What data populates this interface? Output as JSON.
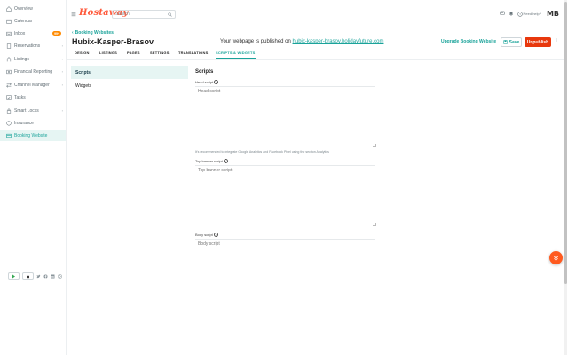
{
  "app": {
    "logo_text": "Hostaway",
    "search_placeholder": "Search",
    "need_help": "Need help?",
    "avatar_initials": "MB"
  },
  "sidebar": {
    "items": [
      {
        "label": "Overview",
        "icon": "home-icon"
      },
      {
        "label": "Calendar",
        "icon": "calendar-icon"
      },
      {
        "label": "Inbox",
        "icon": "inbox-icon",
        "badge": "99+"
      },
      {
        "label": "Reservations",
        "icon": "reservations-icon"
      },
      {
        "label": "Listings",
        "icon": "listings-icon"
      },
      {
        "label": "Financial Reporting",
        "icon": "financial-icon"
      },
      {
        "label": "Channel Manager",
        "icon": "channel-icon"
      },
      {
        "label": "Tasks",
        "icon": "tasks-icon"
      },
      {
        "label": "Smart Locks",
        "icon": "lock-icon"
      },
      {
        "label": "Insurance",
        "icon": "insurance-icon"
      },
      {
        "label": "Booking Website",
        "icon": "globe-icon"
      }
    ]
  },
  "header": {
    "breadcrumb": "Booking Websites",
    "title": "Hubix-Kasper-Brasov",
    "published_prefix": "Your webpage is published on",
    "published_url": "hubix-kasper-brasov.holidayfuture.com",
    "upgrade_label": "Upgrade Booking Website",
    "save_label": "Save",
    "unpublish_label": "Unpublish"
  },
  "tabs": [
    {
      "label": "DESIGN"
    },
    {
      "label": "LISTINGS"
    },
    {
      "label": "PAGES"
    },
    {
      "label": "SETTINGS"
    },
    {
      "label": "TRANSLATIONS"
    },
    {
      "label": "SCRIPTS & WIDGETS",
      "active": true
    }
  ],
  "subnav": [
    {
      "label": "Scripts",
      "active": true
    },
    {
      "label": "Widgets"
    }
  ],
  "main": {
    "section_title": "Scripts",
    "head_label": "Head script",
    "head_placeholder": "Head script",
    "head_help": "It's recommended to integrate Google Analytics and Facebook Pixel using the section Analytics",
    "top_banner_label": "Top banner script",
    "top_banner_placeholder": "Top banner script",
    "body_label": "Body script",
    "body_placeholder": "Body script"
  },
  "colors": {
    "accent": "#1aa39a",
    "brand": "#ff5a3c",
    "unpublish": "#e8380d",
    "badge": "#ff8a00"
  }
}
